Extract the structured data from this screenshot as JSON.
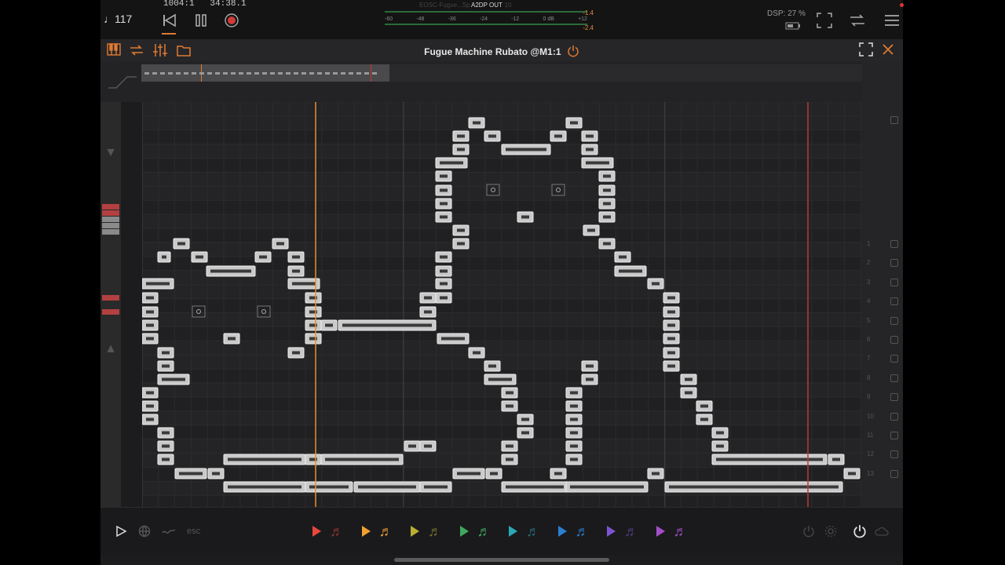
{
  "transport": {
    "tempo": "♩117",
    "position": "1004:1",
    "time": "34:38.1",
    "output_label": "A2DP OUT",
    "track_name": "EOSC-Fugue...Spielaufschlus 10",
    "meter_scale": [
      "-60",
      "-48",
      "-36",
      "-24",
      "-12",
      "0 dB",
      "+12"
    ],
    "peak_left": "-1.4",
    "peak_right": "-2.4",
    "dsp": "DSP: 27 %"
  },
  "plugin": {
    "title": "Fugue Machine Rubato @M1:1"
  },
  "bottom": {
    "esc_label": "esc",
    "track_colors": [
      "#e8483b",
      "#f0a030",
      "#b8b030",
      "#3fa860",
      "#2aa8b8",
      "#2a7fd0",
      "#7a55d0",
      "#a44fc8"
    ]
  },
  "right_rows": [
    "",
    "1",
    "2",
    "3",
    "4",
    "5",
    "6",
    "7",
    "8",
    "9",
    "10",
    "11",
    "12",
    "13"
  ],
  "notes": [
    [
      36,
      177,
      39
    ],
    [
      46,
      160,
      21
    ],
    [
      36,
      195,
      39
    ],
    [
      46,
      212,
      21
    ],
    [
      46,
      230,
      21
    ],
    [
      46,
      248,
      21
    ],
    [
      46,
      266,
      21
    ],
    [
      36,
      299,
      39
    ],
    [
      46,
      284,
      21
    ],
    [
      46,
      320,
      21
    ],
    [
      46,
      338,
      21
    ],
    [
      46,
      355,
      21
    ],
    [
      66,
      202,
      21
    ],
    [
      66,
      213,
      61
    ],
    [
      66,
      235,
      41
    ],
    [
      66,
      248,
      21
    ],
    [
      106,
      195,
      21
    ],
    [
      126,
      181,
      21
    ],
    [
      146,
      163,
      21
    ],
    [
      159,
      145,
      21
    ],
    [
      169,
      163,
      21
    ],
    [
      190,
      181,
      21
    ],
    [
      200,
      195,
      21
    ],
    [
      210,
      212,
      21
    ],
    [
      230,
      248,
      21
    ],
    [
      250,
      266,
      21
    ],
    [
      260,
      284,
      21
    ],
    [
      250,
      302,
      41
    ],
    [
      260,
      320,
      21
    ],
    [
      280,
      338,
      21
    ],
    [
      290,
      355,
      21
    ],
    [
      310,
      373,
      21
    ],
    [
      311,
      391,
      21
    ],
    [
      331,
      409,
      21
    ],
    [
      331,
      427,
      21
    ],
    [
      352,
      445,
      21
    ],
    [
      361,
      457,
      199
    ],
    [
      342,
      473,
      21
    ],
    [
      342,
      491,
      21
    ],
    [
      322,
      509,
      21
    ],
    [
      322,
      527,
      21
    ],
    [
      312,
      545,
      21
    ],
    [
      284,
      527,
      41
    ],
    [
      250,
      463,
      21
    ],
    [
      250,
      491,
      21
    ],
    [
      230,
      473,
      41
    ],
    [
      210,
      459,
      21
    ],
    [
      190,
      449,
      21
    ],
    [
      170,
      455,
      41
    ],
    [
      158,
      491,
      39
    ],
    [
      138,
      508,
      21
    ],
    [
      130,
      545,
      21
    ],
    [
      140,
      559,
      21
    ],
    [
      150,
      577,
      21
    ],
    [
      160,
      599,
      21
    ],
    [
      180,
      617,
      21
    ],
    [
      200,
      635,
      21
    ],
    [
      214,
      656,
      21
    ],
    [
      214,
      680,
      21
    ],
    [
      204,
      701,
      21
    ],
    [
      194,
      722,
      21
    ],
    [
      176,
      742,
      39
    ],
    [
      162,
      760,
      21
    ],
    [
      142,
      781,
      21
    ],
    [
      142,
      801,
      21
    ],
    [
      122,
      821,
      21
    ],
    [
      106,
      849,
      21
    ],
    [
      86,
      868,
      21
    ],
    [
      66,
      887,
      21
    ],
    [
      56,
      907,
      21
    ],
    [
      46,
      933,
      21
    ],
    [
      36,
      957,
      21
    ],
    [
      26,
      971,
      21
    ],
    [
      8,
      151,
      79
    ],
    [
      8,
      233,
      79
    ],
    [
      8,
      262,
      69
    ],
    [
      8,
      334,
      79
    ],
    [
      8,
      397,
      79
    ],
    [
      8,
      418,
      79
    ],
    [
      8,
      427,
      99
    ],
    [
      8,
      449,
      21
    ],
    [
      8,
      457,
      55
    ],
    [
      8,
      472,
      21
    ],
    [
      8,
      488,
      101
    ],
    [
      8,
      530,
      21
    ],
    [
      8,
      587,
      21
    ],
    [
      8,
      607,
      21
    ],
    [
      8,
      629,
      21
    ],
    [
      8,
      652,
      21
    ],
    [
      8,
      670,
      99
    ],
    [
      8,
      800,
      21
    ],
    [
      8,
      849,
      205
    ],
    [
      26,
      885,
      61
    ],
    [
      18,
      880,
      145
    ],
    [
      26,
      953,
      21
    ],
    [
      18,
      968,
      21
    ],
    [
      26,
      1000,
      21
    ],
    [
      26,
      1015,
      21
    ],
    [
      26,
      1018,
      21
    ]
  ]
}
